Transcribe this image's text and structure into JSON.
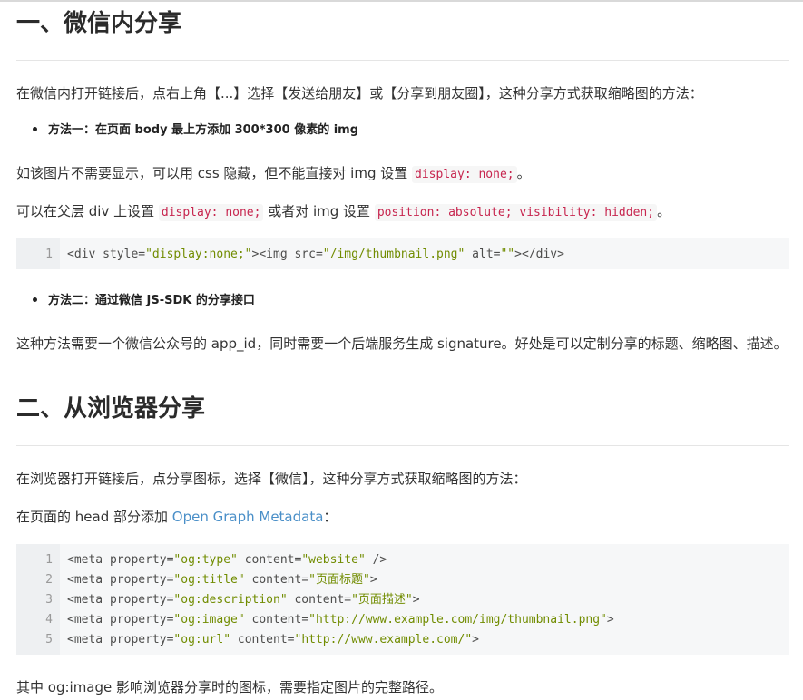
{
  "section1": {
    "heading": "一、微信内分享",
    "intro": "在微信内打开链接后，点右上角【...】选择【发送给朋友】或【分享到朋友圈】，这种分享方式获取缩略图的方法：",
    "method1": "方法一：在页面 body 最上方添加 300*300 像素的 img",
    "p1_a": "如该图片不需要显示，可以用 css 隐藏，但不能直接对 img 设置 ",
    "p1_code": "display: none;",
    "p1_b": "。",
    "p2_a": "可以在父层 div 上设置 ",
    "p2_code1": "display: none;",
    "p2_b": " 或者对 img 设置 ",
    "p2_code2": "position: absolute; visibility: hidden;",
    "p2_c": "。",
    "code1": {
      "line_number": "1",
      "open": "<div",
      "attr1": " style=",
      "val1": "\"display:none;\"",
      "mid": "><img",
      "attr2": " src=",
      "val2": "\"/img/thumbnail.png\"",
      "attr3": " alt=",
      "val3": "\"\"",
      "close": "></div>"
    },
    "method2": "方法二：通过微信 JS-SDK 的分享接口",
    "p3": "这种方法需要一个微信公众号的 app_id，同时需要一个后端服务生成 signature。好处是可以定制分享的标题、缩略图、描述。"
  },
  "section2": {
    "heading": "二、从浏览器分享",
    "intro": "在浏览器打开链接后，点分享图标，选择【微信】，这种分享方式获取缩略图的方法：",
    "p1_a": "在页面的 head 部分添加 ",
    "p1_link": "Open Graph Metadata",
    "p1_b": "：",
    "code2": [
      {
        "n": "1",
        "prop": "\"og:type\"",
        "content": "\"website\"",
        "end": " />"
      },
      {
        "n": "2",
        "prop": "\"og:title\"",
        "content": "\"页面标题\"",
        "end": ">"
      },
      {
        "n": "3",
        "prop": "\"og:description\"",
        "content": "\"页面描述\"",
        "end": ">"
      },
      {
        "n": "4",
        "prop": "\"og:image\"",
        "content": "\"http://www.example.com/img/thumbnail.png\"",
        "end": ">"
      },
      {
        "n": "5",
        "prop": "\"og:url\"",
        "content": "\"http://www.example.com/\"",
        "end": ">"
      }
    ],
    "code2_tag": "<meta",
    "code2_prop_attr": " property=",
    "code2_content_attr": " content=",
    "p2": "其中 og:image 影响浏览器分享时的图标，需要指定图片的完整路径。"
  }
}
